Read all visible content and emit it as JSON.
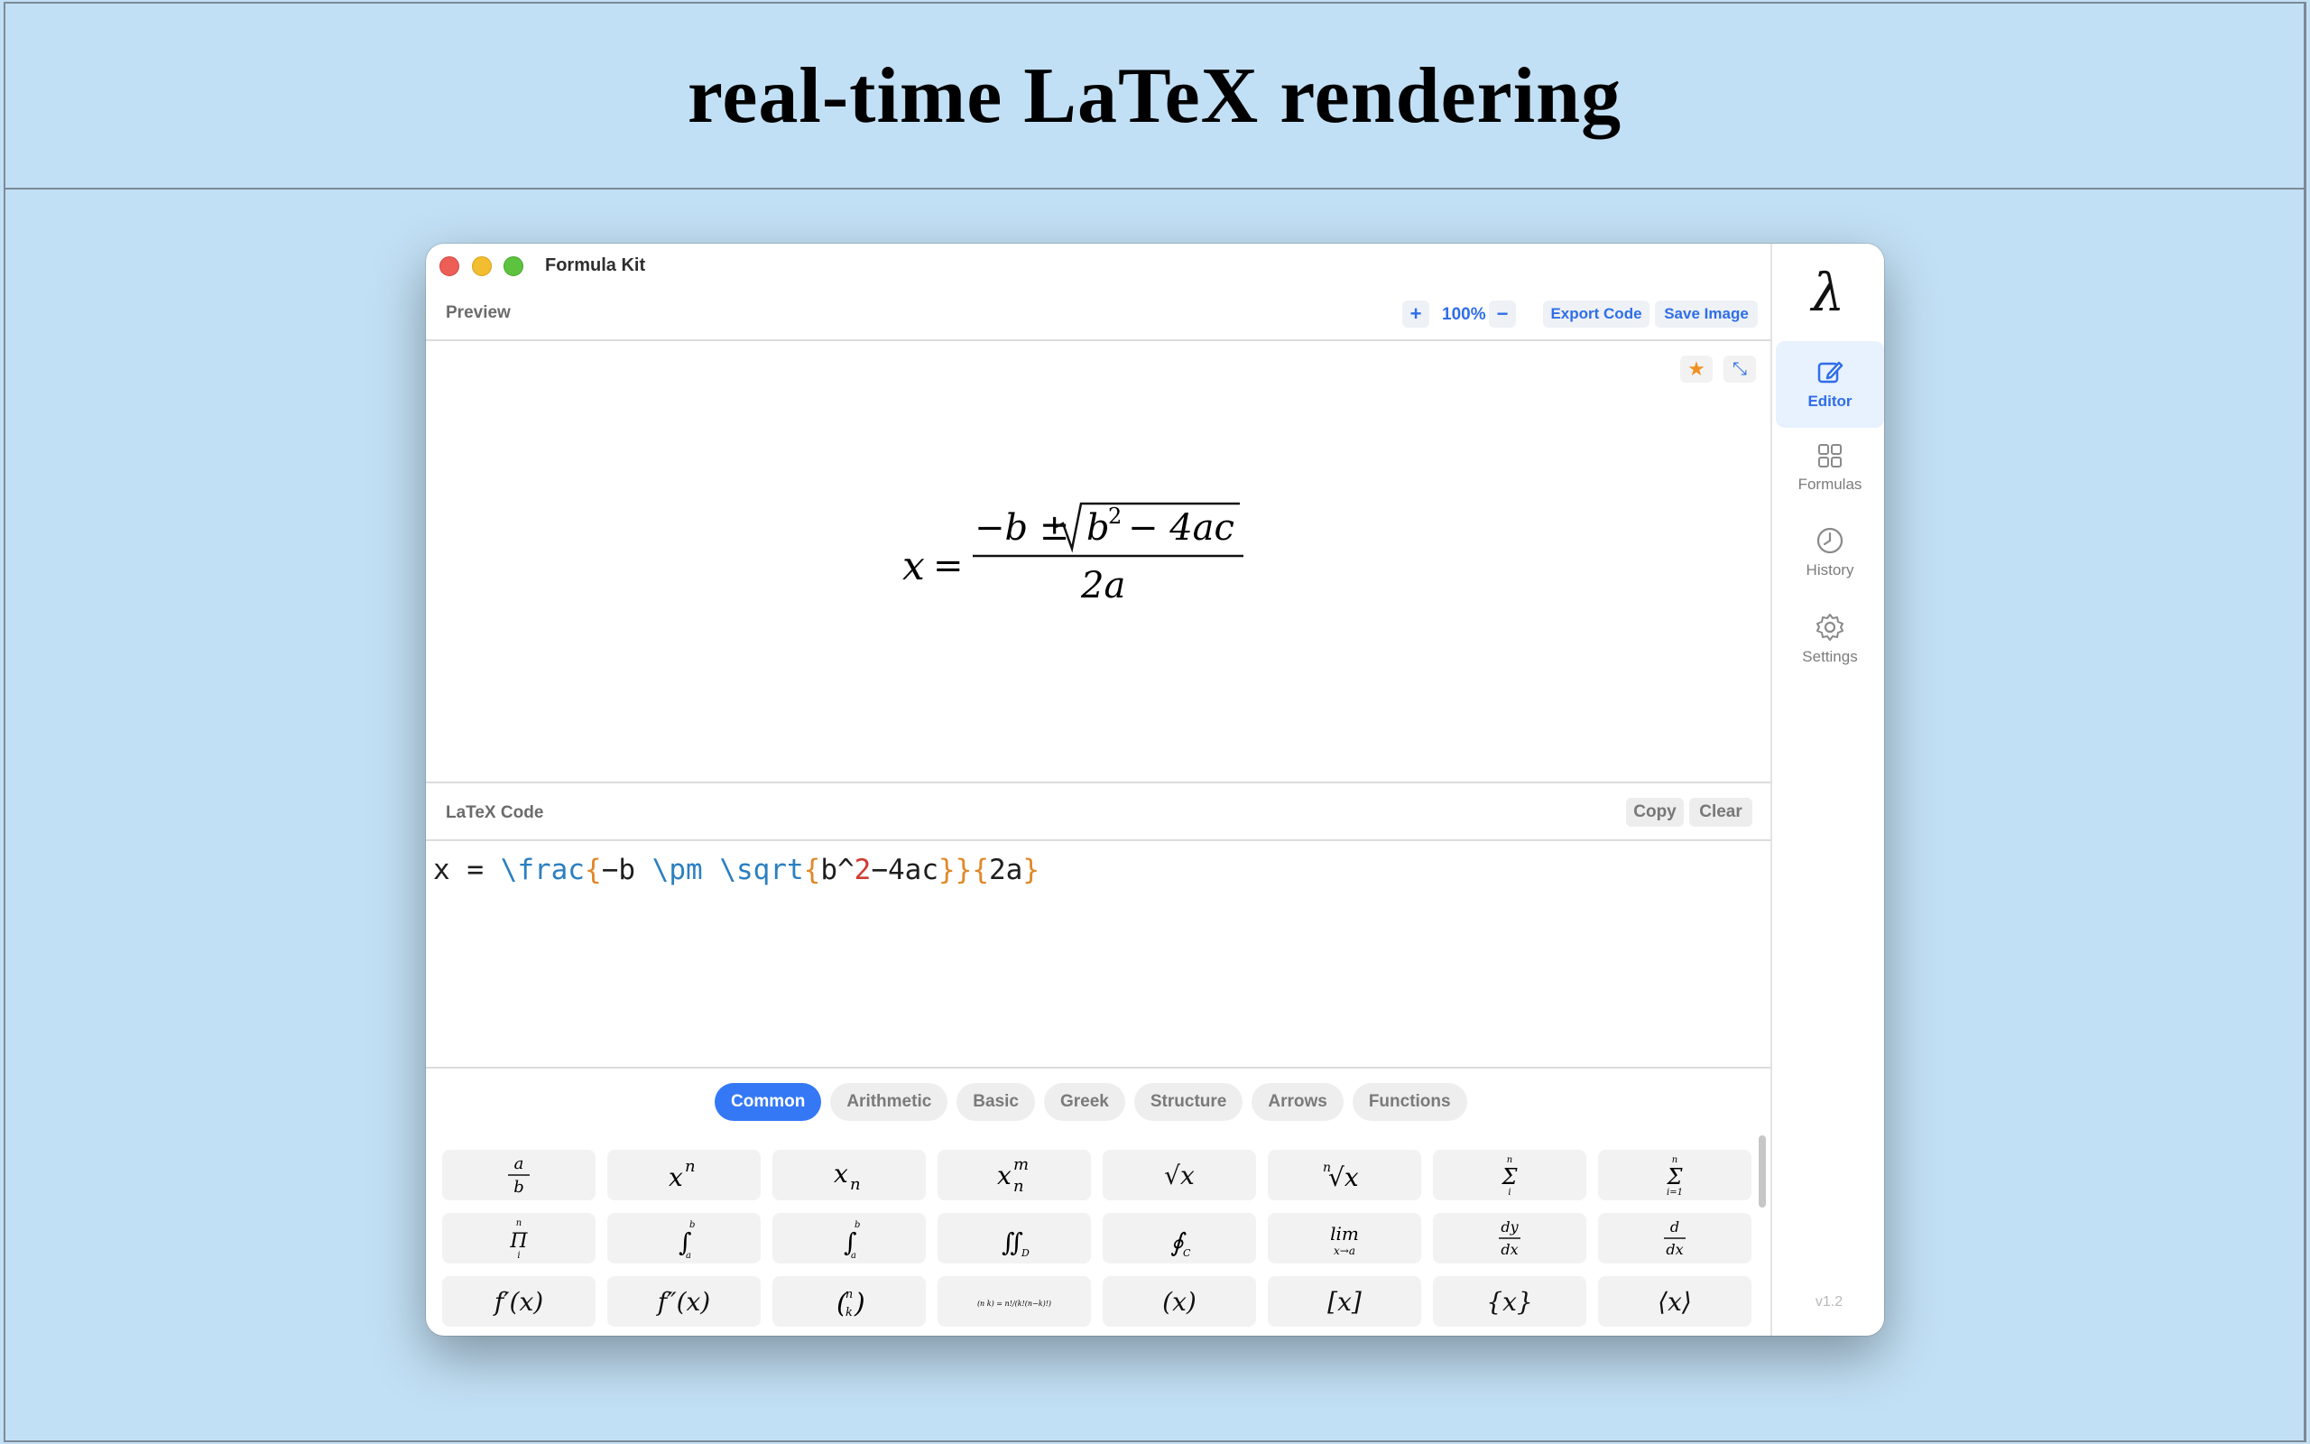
{
  "banner": {
    "title": "real-time LaTeX rendering"
  },
  "window": {
    "title": "Formula Kit"
  },
  "preview": {
    "label": "Preview",
    "zoom_in": "+",
    "zoom": "100%",
    "zoom_out": "−",
    "export_label": "Export Code",
    "save_label": "Save Image",
    "favorite_icon": "star-icon",
    "expand_icon": "expand-icon",
    "formula": {
      "lhs": "x",
      "equals": "=",
      "numerator_prefix": "−b ±",
      "radicand_base": "b",
      "radicand_exp": "2",
      "radicand_rest": "− 4ac",
      "denominator": "2a"
    }
  },
  "latex": {
    "label": "LaTeX Code",
    "copy_label": "Copy",
    "clear_label": "Clear",
    "code_tokens": {
      "t1": "x = ",
      "t2": "\\frac",
      "t3": "{",
      "t4": "−b ",
      "t5": "\\pm",
      "t6": " ",
      "t7": "\\sqrt",
      "t8": "{",
      "t9": "b^",
      "t10": "2",
      "t11": "−4ac",
      "t12": "}}",
      "t13": "{",
      "t14": "2a",
      "t15": "}"
    }
  },
  "tabs": [
    "Common",
    "Arithmetic",
    "Basic",
    "Greek",
    "Structure",
    "Arrows",
    "Functions"
  ],
  "active_tab": "Common",
  "palette": {
    "row3": [
      "f′(x)",
      "f″(x)",
      "",
      "",
      "(x)",
      "[x]",
      "{x}",
      "⟨x⟩"
    ],
    "cells": [
      {
        "top": "a",
        "bottom": "b"
      },
      {
        "base": "x",
        "sup": "n"
      },
      {
        "base": "x",
        "sub": "n"
      },
      {
        "base": "x",
        "sup": "m",
        "sub": "n"
      },
      {
        "root": "√x"
      },
      {
        "nroot_index": "n",
        "nroot": "√x"
      },
      {
        "sum": "Σ",
        "sum_top": "n",
        "sum_bottom": "i"
      },
      {
        "sum": "Σ",
        "sum_top": "n",
        "sum_bottom": "i=1"
      },
      {
        "prod": "Π",
        "prod_top": "n",
        "prod_bottom": "i"
      },
      {
        "int": "∫",
        "int_top": "b",
        "int_bottom": "a"
      },
      {
        "int": "∫",
        "int_top": "b",
        "int_bottom": "a"
      },
      {
        "iint": "∬",
        "iint_sub": "D"
      },
      {
        "oint": "∮",
        "oint_sub": "C"
      },
      {
        "lim": "lim",
        "lim_sub": "x→a"
      },
      {
        "top": "dy",
        "bottom": "dx"
      },
      {
        "top": "d",
        "bottom": "dx"
      },
      {
        "binom_top": "n",
        "binom_bottom": "k"
      },
      {
        "binom_def": "(n k) = n!/(k!(n−k)!)"
      }
    ]
  },
  "sidebar": {
    "logo": "λ",
    "items": [
      {
        "label": "Editor",
        "icon": "edit-icon"
      },
      {
        "label": "Formulas",
        "icon": "grid-icon"
      },
      {
        "label": "History",
        "icon": "clock-icon"
      },
      {
        "label": "Settings",
        "icon": "gear-icon"
      }
    ],
    "version": "v1.2"
  },
  "colors": {
    "accent": "#3478f6",
    "background": "#c2e0f5",
    "code_command": "#2b7fc1",
    "code_brace": "#e08828",
    "code_number": "#d23a2f",
    "favorite": "#f09020"
  }
}
